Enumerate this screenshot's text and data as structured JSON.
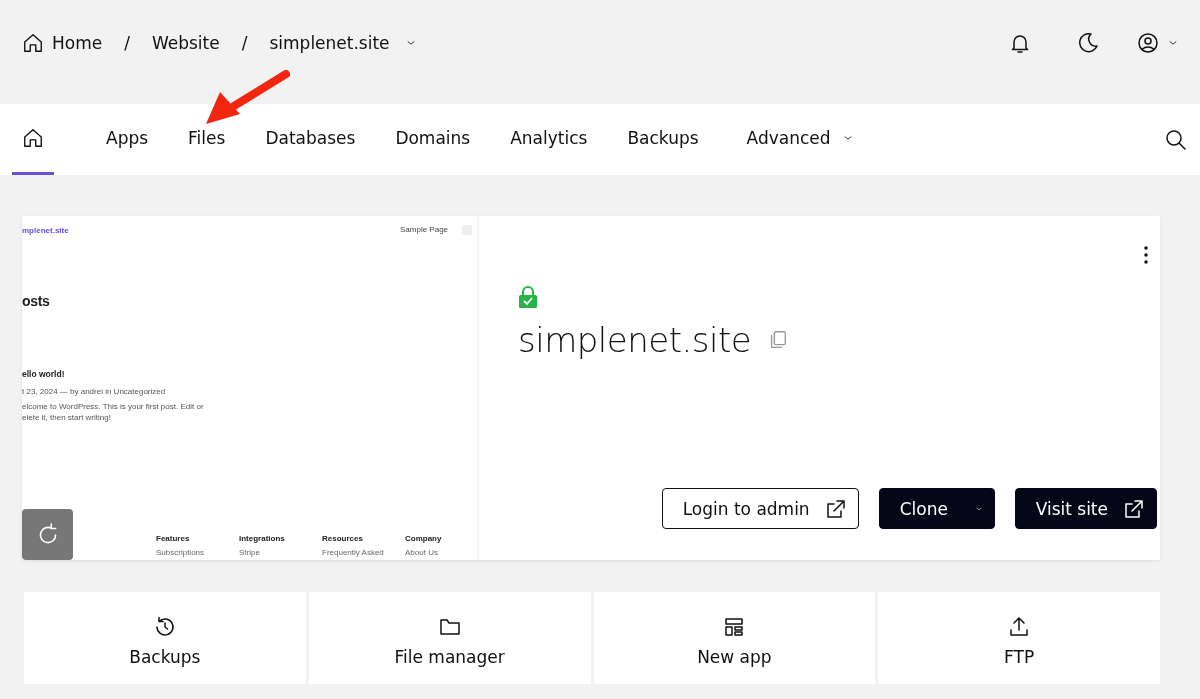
{
  "breadcrumb": [
    {
      "label": "Home",
      "kind": "home"
    },
    {
      "separator": "/",
      "label": "Website",
      "kind": "plain"
    },
    {
      "separator": "/",
      "label": "simplenet.site",
      "kind": "menu"
    }
  ],
  "nav": {
    "tabs": [
      {
        "kind": "home",
        "selected": true
      },
      {
        "kind": "text",
        "label": "Apps",
        "selected": false
      },
      {
        "kind": "text",
        "label": "Files",
        "selected": false
      },
      {
        "kind": "text",
        "label": "Databases",
        "selected": false
      },
      {
        "kind": "text",
        "label": "Domains",
        "selected": false
      },
      {
        "kind": "text",
        "label": "Analytics",
        "selected": false
      },
      {
        "kind": "text",
        "label": "Backups",
        "selected": false
      },
      {
        "kind": "menu",
        "label": "Advanced",
        "selected": false
      }
    ]
  },
  "site": {
    "secure": true,
    "domain": "simplenet.site",
    "preview": {
      "logo": "mplenet.site",
      "menu_link": "Sample Page",
      "heading": "osts",
      "post_title": "ello world!",
      "post_meta": "t 23, 2024 — by andrei in Uncategorized",
      "post_excerpt": [
        "elcome to WordPress. This is your first post. Edit or",
        "elete it, then start writing!"
      ],
      "footer": [
        {
          "title": "Features",
          "link": "Subscriptions"
        },
        {
          "title": "Integrations",
          "link": "Stripe"
        },
        {
          "title": "Resources",
          "link": "Frequently Asked"
        },
        {
          "title": "Company",
          "link": "About Us"
        }
      ]
    },
    "buttons": [
      {
        "label": "Login to admin",
        "kind": "outline"
      },
      {
        "label": "Clone",
        "kind": "menu"
      },
      {
        "label": "Visit site",
        "kind": "solid"
      }
    ]
  },
  "tiles": [
    {
      "label": "Backups",
      "kind": "history"
    },
    {
      "label": "File manager",
      "kind": "folder"
    },
    {
      "label": "New app",
      "kind": "layout"
    },
    {
      "label": "FTP",
      "kind": "upload"
    }
  ]
}
